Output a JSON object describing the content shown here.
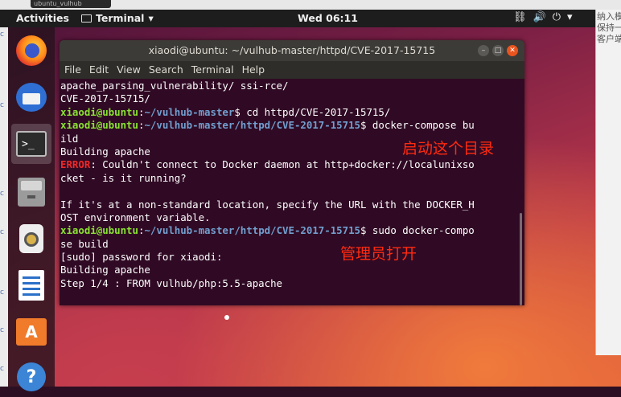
{
  "browser_tab": {
    "label": "ubuntu_vulhub"
  },
  "topbar": {
    "activities": "Activities",
    "app_name": "Terminal",
    "clock": "Wed 06:11",
    "network_icon": "network-icon",
    "volume_icon": "volume-icon",
    "power_icon": "power-icon"
  },
  "dock": {
    "items": [
      "firefox",
      "thunderbird",
      "terminal",
      "files",
      "rhythmbox",
      "libreoffice-writer",
      "ubuntu-software",
      "help"
    ],
    "terminal_glyph": ">_",
    "store_glyph": "A",
    "help_glyph": "?"
  },
  "right_sliver": [
    "纳入模",
    "保持一致性",
    "客户端连"
  ],
  "terminal": {
    "title": "xiaodi@ubuntu: ~/vulhub-master/httpd/CVE-2017-15715",
    "menu": [
      "File",
      "Edit",
      "View",
      "Search",
      "Terminal",
      "Help"
    ],
    "lines": [
      {
        "text": "apache_parsing_vulnerability/ ssi-rce/"
      },
      {
        "text": "CVE-2017-15715/"
      },
      {
        "user": "xiaodi@ubuntu",
        "path": "~/vulhub-master",
        "cmd": "$ cd httpd/CVE-2017-15715/"
      },
      {
        "user": "xiaodi@ubuntu",
        "path": "~/vulhub-master/httpd/CVE-2017-15715",
        "cmd": "$ docker-compose bu"
      },
      {
        "text": "ild"
      },
      {
        "text": "Building apache"
      },
      {
        "err": "ERROR",
        "text": ": Couldn't connect to Docker daemon at http+docker://localunixso"
      },
      {
        "text": "cket - is it running?"
      },
      {
        "text": ""
      },
      {
        "text": "If it's at a non-standard location, specify the URL with the DOCKER_H"
      },
      {
        "text": "OST environment variable."
      },
      {
        "user": "xiaodi@ubuntu",
        "path": "~/vulhub-master/httpd/CVE-2017-15715",
        "cmd": "$ sudo docker-compo"
      },
      {
        "text": "se build"
      },
      {
        "text": "[sudo] password for xiaodi:"
      },
      {
        "text": "Building apache"
      },
      {
        "text": "Step 1/4 : FROM vulhub/php:5.5-apache"
      }
    ]
  },
  "annotations": {
    "first": "启动这个目录",
    "second": "管理员打开"
  },
  "colors": {
    "terminal_bg": "#300a24",
    "user": "#8ae234",
    "path": "#729fcf",
    "error": "#ef2929",
    "annotation": "#ff2a10"
  }
}
